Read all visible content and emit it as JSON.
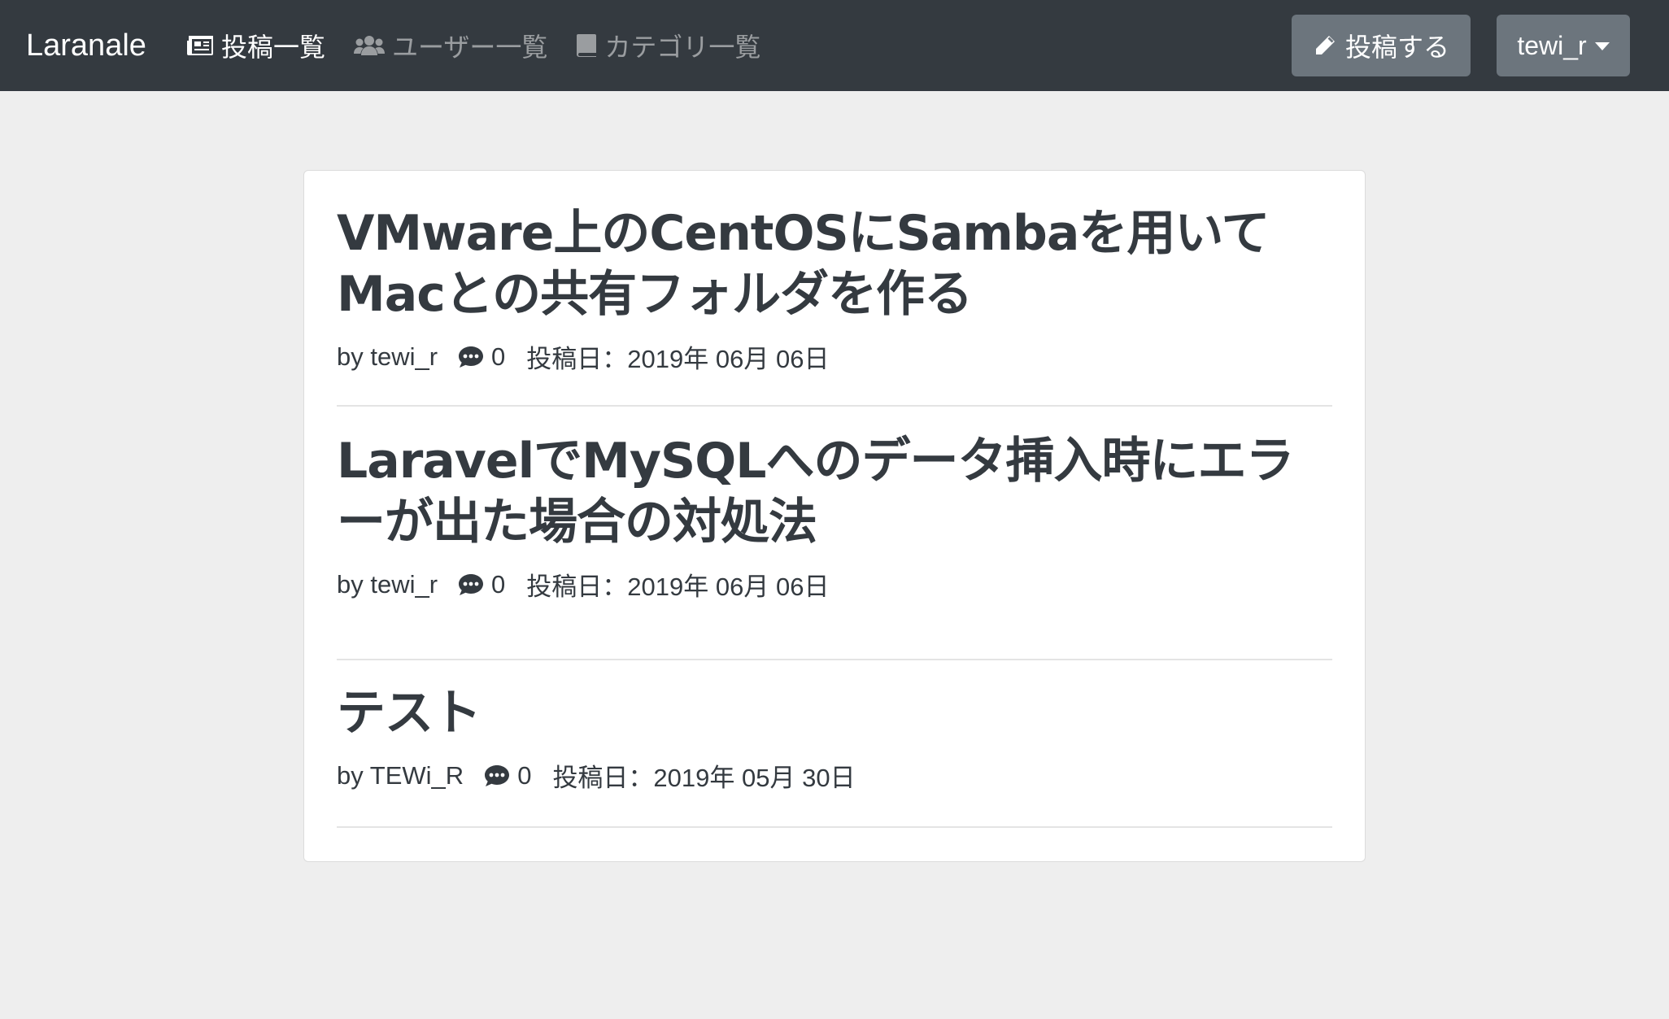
{
  "navbar": {
    "brand": "Laranale",
    "links": [
      {
        "label": "投稿一覧",
        "icon": "newspaper-icon",
        "active": true
      },
      {
        "label": "ユーザー一覧",
        "icon": "users-icon",
        "active": false
      },
      {
        "label": "カテゴリ一覧",
        "icon": "book-icon",
        "active": false
      }
    ],
    "post_button": {
      "label": "投稿する",
      "icon": "pencil-icon"
    },
    "user_menu": {
      "label": "tewi_r",
      "icon": "caret-down-icon"
    }
  },
  "posts": [
    {
      "title_line1": "VMware上のCentOSにSambaを用いて",
      "title_line2": "Macとの共有フォルダを作る",
      "author": "by tewi_r",
      "comments": "0",
      "date": "投稿日：2019年 06月 06日"
    },
    {
      "title_line1": "LaravelでMySQLへのデータ挿入時にエラ",
      "title_line2": "ーが出た場合の対処法",
      "author": "by tewi_r",
      "comments": "0",
      "date": "投稿日：2019年 06月 06日"
    },
    {
      "title_line1": "テスト",
      "author": "by TEWi_R",
      "comments": "0",
      "date": "投稿日：2019年 05月 30日"
    }
  ],
  "colors": {
    "navbar": "#343a40",
    "background": "#eeeeee",
    "button": "#6c757d",
    "card": "#ffffff"
  }
}
